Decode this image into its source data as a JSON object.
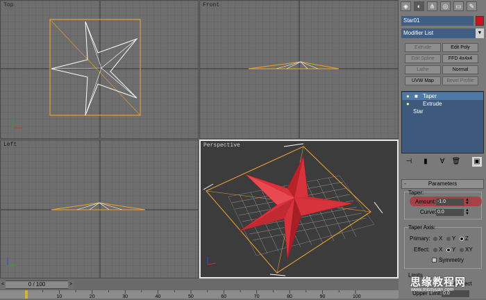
{
  "viewports": {
    "top_label": "Top",
    "front_label": "Front",
    "left_label": "Left",
    "perspective_label": "Perspective"
  },
  "panel": {
    "object_name": "Star01",
    "object_color": "#c8141e",
    "modifier_list": "Modifier List",
    "buttons": [
      {
        "label": "Extrude",
        "enabled": false
      },
      {
        "label": "Edit Poly",
        "enabled": true
      },
      {
        "label": "Edit Spline",
        "enabled": false
      },
      {
        "label": "FFD 4x4x4",
        "enabled": true
      },
      {
        "label": "Lathe",
        "enabled": false
      },
      {
        "label": "Normal",
        "enabled": true
      },
      {
        "label": "UVW Map",
        "enabled": true
      },
      {
        "label": "Bevel Profile",
        "enabled": false
      }
    ],
    "stack": [
      "Taper",
      "Extrude",
      "Star"
    ],
    "parameters_title": "Parameters",
    "taper_group": "Taper:",
    "amount_label": "Amount:",
    "amount_value": "-1.0",
    "curve_label": "Curve:",
    "curve_value": "0.0",
    "taper_axis_group": "Taper Axis:",
    "primary_label": "Primary:",
    "effect_label": "Effect:",
    "primary_options": [
      "X",
      "Y",
      "Z"
    ],
    "primary_selected": "Z",
    "effect_options": [
      "X",
      "Y",
      "XY"
    ],
    "effect_selected": "Y",
    "symmetry_label": "Symmetry",
    "limits_label": "Limits",
    "upper_limit_label": "Upper Limit:",
    "upper_limit_value": "0.0",
    "limit_effect_label": "Limit Effect"
  },
  "timeline": {
    "frame_display": "0 / 100",
    "ticks": [
      "10",
      "20",
      "30",
      "40",
      "50",
      "60",
      "70",
      "80",
      "90",
      "100"
    ]
  },
  "watermark": {
    "title": "思缘教程网",
    "url": "www.missyuan.com"
  },
  "colors": {
    "selection": "#e8a030",
    "star_red": "#d8323c",
    "accent_blue": "#3f5e82"
  }
}
